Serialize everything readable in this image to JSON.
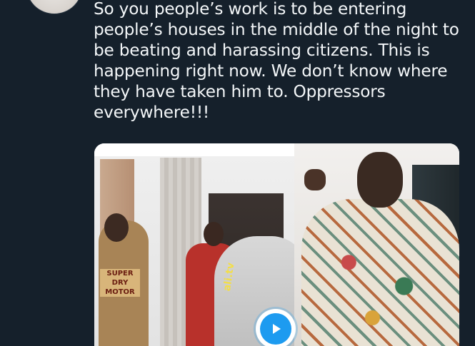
{
  "tweet": {
    "text": "So you people’s work is to be entering\npeople’s houses in the middle of the night to\nbe beating and harassing citizens. This is\nhappening right now. We don’t know where\nthey have taken him to. Oppressors\neverywhere!!!"
  },
  "media": {
    "left_image_text": "SUPER\nDRY\nMOTOR",
    "watermark_text": "ali.tv",
    "play_icon": "play-icon"
  },
  "colors": {
    "background": "#15202b",
    "text": "#f3f6f8",
    "accent": "#1d9bf0"
  }
}
